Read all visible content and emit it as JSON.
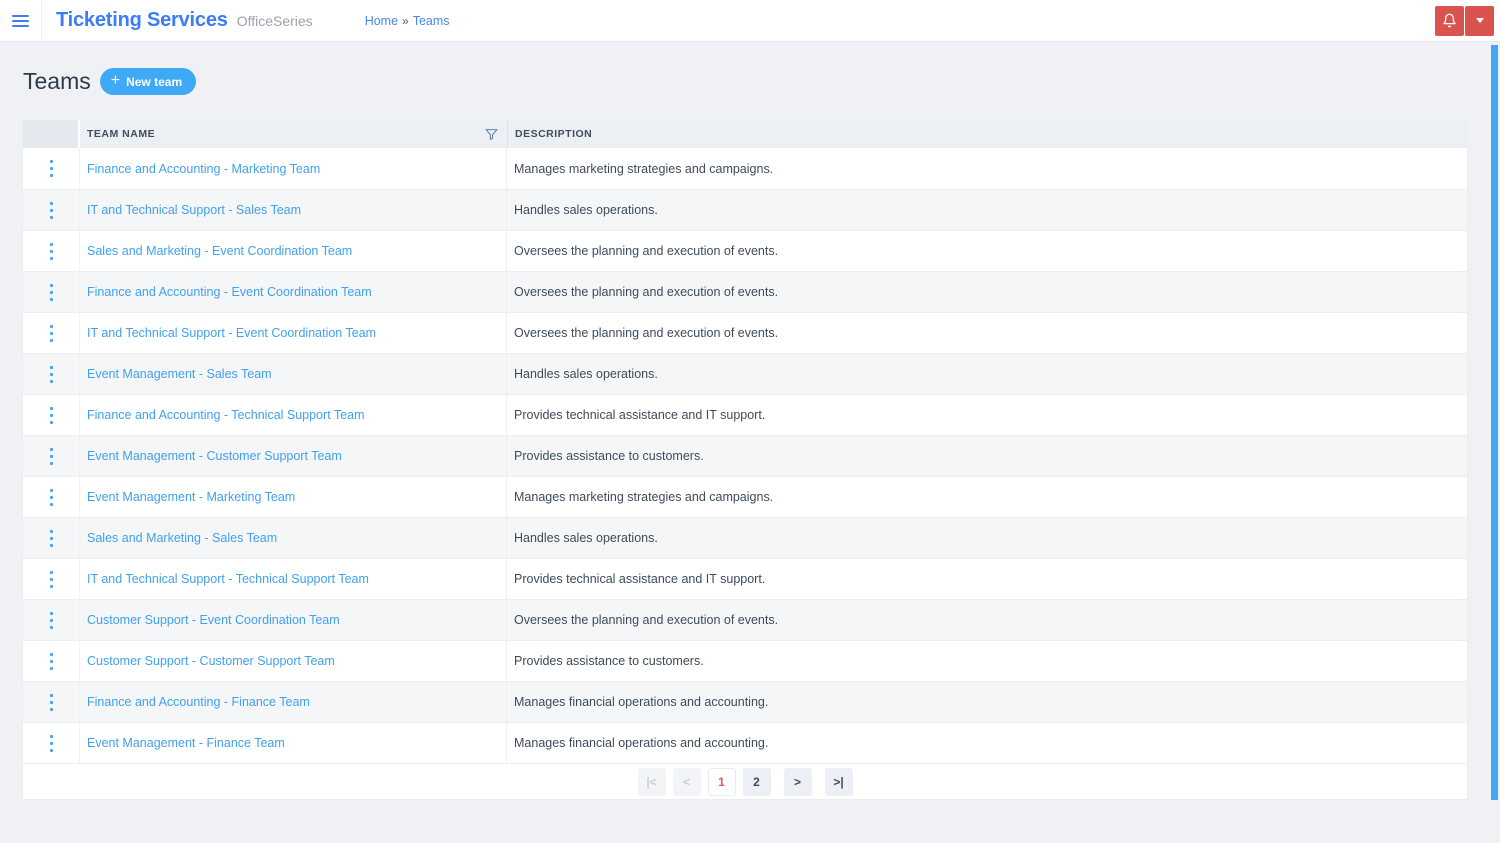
{
  "header": {
    "title": "Ticketing Services",
    "subtitle": "OfficeSeries",
    "breadcrumb": {
      "home": "Home",
      "separator": "»",
      "current": "Teams"
    }
  },
  "icons": {
    "hamburger": "menu-icon",
    "notifications": "bell-icon",
    "account_dropdown": "caret-down-icon",
    "new_team": "plus-icon",
    "column_filter": "funnel-icon",
    "row_actions": "kebab-vertical-dots-icon"
  },
  "page": {
    "title": "Teams",
    "new_team_button": "New team",
    "plus": "+"
  },
  "table": {
    "columns": {
      "team_name": "TEAM NAME",
      "description": "DESCRIPTION"
    },
    "rows": [
      {
        "name": "Finance and Accounting - Marketing Team",
        "description": "Manages marketing strategies and campaigns."
      },
      {
        "name": "IT and Technical Support - Sales Team",
        "description": "Handles sales operations."
      },
      {
        "name": "Sales and Marketing - Event Coordination Team",
        "description": "Oversees the planning and execution of events."
      },
      {
        "name": "Finance and Accounting - Event Coordination Team",
        "description": "Oversees the planning and execution of events."
      },
      {
        "name": "IT and Technical Support - Event Coordination Team",
        "description": "Oversees the planning and execution of events."
      },
      {
        "name": "Event Management - Sales Team",
        "description": "Handles sales operations."
      },
      {
        "name": "Finance and Accounting - Technical Support Team",
        "description": "Provides technical assistance and IT support."
      },
      {
        "name": "Event Management - Customer Support Team",
        "description": "Provides assistance to customers."
      },
      {
        "name": "Event Management - Marketing Team",
        "description": "Manages marketing strategies and campaigns."
      },
      {
        "name": "Sales and Marketing - Sales Team",
        "description": "Handles sales operations."
      },
      {
        "name": "IT and Technical Support - Technical Support Team",
        "description": "Provides technical assistance and IT support."
      },
      {
        "name": "Customer Support - Event Coordination Team",
        "description": "Oversees the planning and execution of events."
      },
      {
        "name": "Customer Support - Customer Support Team",
        "description": "Provides assistance to customers."
      },
      {
        "name": "Finance and Accounting - Finance Team",
        "description": "Manages financial operations and accounting."
      },
      {
        "name": "Event Management - Finance Team",
        "description": "Manages financial operations and accounting."
      }
    ]
  },
  "pagination": {
    "first": "|<",
    "prev": "<",
    "pages": [
      "1",
      "2"
    ],
    "current_page": "1",
    "next": ">",
    "last": ">|"
  },
  "colors": {
    "brand_blue": "#3b7cf7",
    "button_blue": "#3fa9f5",
    "link_blue": "#42a0ed",
    "danger_red": "#d9534f",
    "active_page_red": "#e05a52",
    "scrollbar_blue": "#46a3f8",
    "table_header_bg": "#ecf0f4",
    "alt_row_bg": "#f4f6f8"
  }
}
